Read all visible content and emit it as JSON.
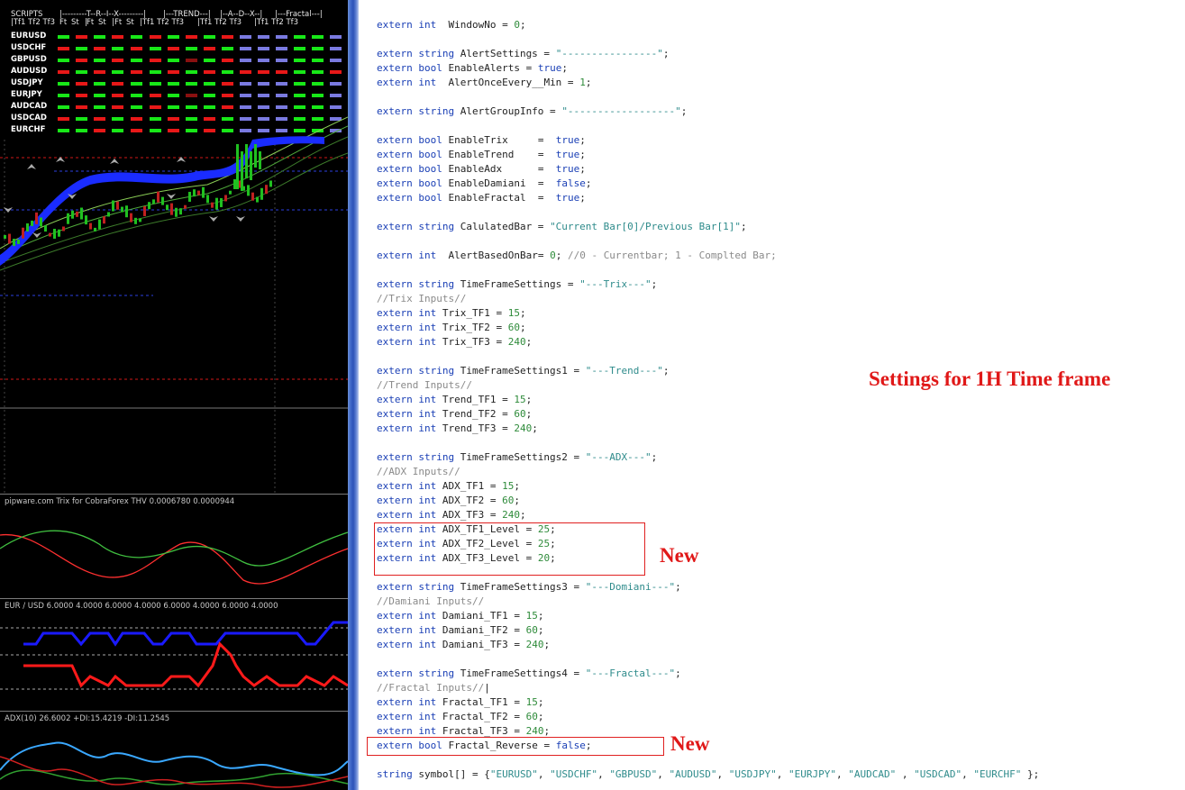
{
  "dashboard": {
    "header_groups": [
      "SCRIPTS",
      "|---------T--R--I--X---------|",
      "|---TREND---|",
      "|--A--D--X--|",
      "|---Fractal---|"
    ],
    "header_tfs": [
      "|Tf1 Tf2 Tf3",
      "Ft",
      "St",
      "|",
      "Ft",
      "St",
      "|",
      "Ft",
      "St",
      "|Tf1 Tf2 Tf3",
      "|Tf1 Tf2 Tf3",
      "|Tf1 Tf2 Tf3"
    ],
    "symbols": [
      "EURUSD",
      "USDCHF",
      "GBPUSD",
      "AUDUSD",
      "USDJPY",
      "EURJPY",
      "AUDCAD",
      "USDCAD",
      "EURCHF"
    ],
    "colors": {
      "green": "#18e818",
      "red": "#e81818",
      "blue": "#7a7ae0",
      "dark": "#8a1010"
    },
    "grid": [
      [
        "g",
        "r",
        "g",
        "r",
        "g",
        "r",
        "g",
        "r",
        "g",
        "r",
        "b"
      ],
      [
        "r",
        "g",
        "r",
        "g",
        "r",
        "g",
        "r",
        "g",
        "r",
        "g",
        "b"
      ],
      [
        "g",
        "r",
        "g",
        "r",
        "g",
        "r",
        "g",
        "d",
        "g",
        "r",
        "b"
      ],
      [
        "r",
        "g",
        "r",
        "g",
        "r",
        "g",
        "r",
        "g",
        "r",
        "g",
        "r"
      ],
      [
        "g",
        "r",
        "g",
        "r",
        "g",
        "g",
        "g",
        "g",
        "g",
        "r",
        "b"
      ],
      [
        "g",
        "r",
        "g",
        "r",
        "g",
        "r",
        "g",
        "d",
        "g",
        "r",
        "b"
      ],
      [
        "g",
        "r",
        "g",
        "r",
        "g",
        "r",
        "g",
        "g",
        "g",
        "r",
        "b"
      ],
      [
        "r",
        "g",
        "r",
        "g",
        "r",
        "g",
        "r",
        "g",
        "r",
        "g",
        "b"
      ],
      [
        "g",
        "g",
        "r",
        "g",
        "r",
        "g",
        "r",
        "g",
        "r",
        "g",
        "b"
      ]
    ]
  },
  "panes": {
    "trix_title": "pipware.com Trix for CobraForex THV 0.0006780 0.0000944",
    "adx_lines_title": "EUR / USD 6.0000 4.0000 6.0000 4.0000 6.0000 4.0000 6.0000 4.0000",
    "adx_title": "ADX(10) 26.6002 +DI:15.4219 -DI:11.2545"
  },
  "code": [
    [
      [
        "kw",
        "extern int"
      ],
      [
        "t",
        "  WindowNo = "
      ],
      [
        "num",
        "0"
      ],
      [
        "t",
        ";"
      ]
    ],
    [],
    [
      [
        "kw",
        "extern string"
      ],
      [
        "t",
        " AlertSettings = "
      ],
      [
        "str",
        "\"----------------\""
      ],
      [
        "t",
        ";"
      ]
    ],
    [
      [
        "kw",
        "extern bool"
      ],
      [
        "t",
        " EnableAlerts = "
      ],
      [
        "kw",
        "true"
      ],
      [
        "t",
        ";"
      ]
    ],
    [
      [
        "kw",
        "extern int"
      ],
      [
        "t",
        "  AlertOnceEvery__Min = "
      ],
      [
        "num",
        "1"
      ],
      [
        "t",
        ";"
      ]
    ],
    [],
    [
      [
        "kw",
        "extern string"
      ],
      [
        "t",
        " AlertGroupInfo = "
      ],
      [
        "str",
        "\"------------------\""
      ],
      [
        "t",
        ";"
      ]
    ],
    [],
    [
      [
        "kw",
        "extern bool"
      ],
      [
        "t",
        " EnableTrix     =  "
      ],
      [
        "kw",
        "true"
      ],
      [
        "t",
        ";"
      ]
    ],
    [
      [
        "kw",
        "extern bool"
      ],
      [
        "t",
        " EnableTrend    =  "
      ],
      [
        "kw",
        "true"
      ],
      [
        "t",
        ";"
      ]
    ],
    [
      [
        "kw",
        "extern bool"
      ],
      [
        "t",
        " EnableAdx      =  "
      ],
      [
        "kw",
        "true"
      ],
      [
        "t",
        ";"
      ]
    ],
    [
      [
        "kw",
        "extern bool"
      ],
      [
        "t",
        " EnableDamiani  =  "
      ],
      [
        "kw",
        "false"
      ],
      [
        "t",
        ";"
      ]
    ],
    [
      [
        "kw",
        "extern bool"
      ],
      [
        "t",
        " EnableFractal  =  "
      ],
      [
        "kw",
        "true"
      ],
      [
        "t",
        ";"
      ]
    ],
    [],
    [
      [
        "kw",
        "extern string"
      ],
      [
        "t",
        " CalulatedBar = "
      ],
      [
        "str",
        "\"Current Bar[0]/Previous Bar[1]\""
      ],
      [
        "t",
        ";"
      ]
    ],
    [],
    [
      [
        "kw",
        "extern int"
      ],
      [
        "t",
        "  AlertBasedOnBar= "
      ],
      [
        "num",
        "0"
      ],
      [
        "t",
        "; "
      ],
      [
        "cmt",
        "//0 - Currentbar; 1 - Complted Bar;"
      ]
    ],
    [],
    [
      [
        "kw",
        "extern string"
      ],
      [
        "t",
        " TimeFrameSettings = "
      ],
      [
        "str",
        "\"---Trix---\""
      ],
      [
        "t",
        ";"
      ]
    ],
    [
      [
        "cmt",
        "//Trix Inputs//"
      ]
    ],
    [
      [
        "kw",
        "extern int"
      ],
      [
        "t",
        " Trix_TF1 = "
      ],
      [
        "num",
        "15"
      ],
      [
        "t",
        ";"
      ]
    ],
    [
      [
        "kw",
        "extern int"
      ],
      [
        "t",
        " Trix_TF2 = "
      ],
      [
        "num",
        "60"
      ],
      [
        "t",
        ";"
      ]
    ],
    [
      [
        "kw",
        "extern int"
      ],
      [
        "t",
        " Trix_TF3 = "
      ],
      [
        "num",
        "240"
      ],
      [
        "t",
        ";"
      ]
    ],
    [],
    [
      [
        "kw",
        "extern string"
      ],
      [
        "t",
        " TimeFrameSettings1 = "
      ],
      [
        "str",
        "\"---Trend---\""
      ],
      [
        "t",
        ";"
      ]
    ],
    [
      [
        "cmt",
        "//Trend Inputs//"
      ]
    ],
    [
      [
        "kw",
        "extern int"
      ],
      [
        "t",
        " Trend_TF1 = "
      ],
      [
        "num",
        "15"
      ],
      [
        "t",
        ";"
      ]
    ],
    [
      [
        "kw",
        "extern int"
      ],
      [
        "t",
        " Trend_TF2 = "
      ],
      [
        "num",
        "60"
      ],
      [
        "t",
        ";"
      ]
    ],
    [
      [
        "kw",
        "extern int"
      ],
      [
        "t",
        " Trend_TF3 = "
      ],
      [
        "num",
        "240"
      ],
      [
        "t",
        ";"
      ]
    ],
    [],
    [
      [
        "kw",
        "extern string"
      ],
      [
        "t",
        " TimeFrameSettings2 = "
      ],
      [
        "str",
        "\"---ADX---\""
      ],
      [
        "t",
        ";"
      ]
    ],
    [
      [
        "cmt",
        "//ADX Inputs//"
      ]
    ],
    [
      [
        "kw",
        "extern int"
      ],
      [
        "t",
        " ADX_TF1 = "
      ],
      [
        "num",
        "15"
      ],
      [
        "t",
        ";"
      ]
    ],
    [
      [
        "kw",
        "extern int"
      ],
      [
        "t",
        " ADX_TF2 = "
      ],
      [
        "num",
        "60"
      ],
      [
        "t",
        ";"
      ]
    ],
    [
      [
        "kw",
        "extern int"
      ],
      [
        "t",
        " ADX_TF3 = "
      ],
      [
        "num",
        "240"
      ],
      [
        "t",
        ";"
      ]
    ],
    [
      [
        "kw",
        "extern int"
      ],
      [
        "t",
        " ADX_TF1_Level = "
      ],
      [
        "num",
        "25"
      ],
      [
        "t",
        ";"
      ]
    ],
    [
      [
        "kw",
        "extern int"
      ],
      [
        "t",
        " ADX_TF2_Level = "
      ],
      [
        "num",
        "25"
      ],
      [
        "t",
        ";"
      ]
    ],
    [
      [
        "kw",
        "extern int"
      ],
      [
        "t",
        " ADX_TF3_Level = "
      ],
      [
        "num",
        "20"
      ],
      [
        "t",
        ";"
      ]
    ],
    [],
    [
      [
        "kw",
        "extern string"
      ],
      [
        "t",
        " TimeFrameSettings3 = "
      ],
      [
        "str",
        "\"---Domiani---\""
      ],
      [
        "t",
        ";"
      ]
    ],
    [
      [
        "cmt",
        "//Damiani Inputs//"
      ]
    ],
    [
      [
        "kw",
        "extern int"
      ],
      [
        "t",
        " Damiani_TF1 = "
      ],
      [
        "num",
        "15"
      ],
      [
        "t",
        ";"
      ]
    ],
    [
      [
        "kw",
        "extern int"
      ],
      [
        "t",
        " Damiani_TF2 = "
      ],
      [
        "num",
        "60"
      ],
      [
        "t",
        ";"
      ]
    ],
    [
      [
        "kw",
        "extern int"
      ],
      [
        "t",
        " Damiani_TF3 = "
      ],
      [
        "num",
        "240"
      ],
      [
        "t",
        ";"
      ]
    ],
    [],
    [
      [
        "kw",
        "extern string"
      ],
      [
        "t",
        " TimeFrameSettings4 = "
      ],
      [
        "str",
        "\"---Fractal---\""
      ],
      [
        "t",
        ";"
      ]
    ],
    [
      [
        "cmt",
        "//Fractal Inputs//"
      ],
      [
        "t",
        "|"
      ]
    ],
    [
      [
        "kw",
        "extern int"
      ],
      [
        "t",
        " Fractal_TF1 = "
      ],
      [
        "num",
        "15"
      ],
      [
        "t",
        ";"
      ]
    ],
    [
      [
        "kw",
        "extern int"
      ],
      [
        "t",
        " Fractal_TF2 = "
      ],
      [
        "num",
        "60"
      ],
      [
        "t",
        ";"
      ]
    ],
    [
      [
        "kw",
        "extern int"
      ],
      [
        "t",
        " Fractal_TF3 = "
      ],
      [
        "num",
        "240"
      ],
      [
        "t",
        ";"
      ]
    ],
    [
      [
        "kw",
        "extern bool"
      ],
      [
        "t",
        " Fractal_Reverse = "
      ],
      [
        "kw",
        "false"
      ],
      [
        "t",
        ";"
      ]
    ],
    [],
    [
      [
        "kw",
        "string"
      ],
      [
        "t",
        " symbol[] = {"
      ],
      [
        "str",
        "\"EURUSD\""
      ],
      [
        "t",
        ", "
      ],
      [
        "str",
        "\"USDCHF\""
      ],
      [
        "t",
        ", "
      ],
      [
        "str",
        "\"GBPUSD\""
      ],
      [
        "t",
        ", "
      ],
      [
        "str",
        "\"AUDUSD\""
      ],
      [
        "t",
        ", "
      ],
      [
        "str",
        "\"USDJPY\""
      ],
      [
        "t",
        ", "
      ],
      [
        "str",
        "\"EURJPY\""
      ],
      [
        "t",
        ", "
      ],
      [
        "str",
        "\"AUDCAD\""
      ],
      [
        "t",
        " , "
      ],
      [
        "str",
        "\"USDCAD\""
      ],
      [
        "t",
        ", "
      ],
      [
        "str",
        "\"EURCHF\""
      ],
      [
        "t",
        " };"
      ]
    ]
  ],
  "annotations": {
    "settings_label": "Settings for 1H Time frame",
    "new_label_1": "New",
    "new_label_2": "New"
  }
}
